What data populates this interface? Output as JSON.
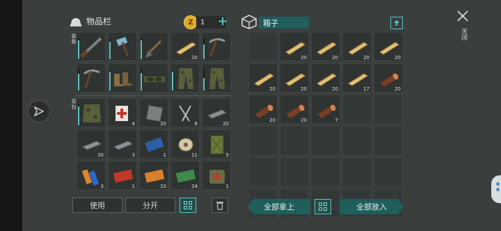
{
  "inventory": {
    "title": "物品栏",
    "coins": "1",
    "equip_label": "装备",
    "backpack_label": "背包",
    "equip_slots": [
      {
        "icon": "shotgun-icon",
        "count": "",
        "durability": 0.9
      },
      {
        "icon": "sledgehammer-icon",
        "count": "",
        "durability": 0.85
      },
      {
        "icon": "shovel-icon",
        "count": "",
        "durability": 0.9
      },
      {
        "icon": "wood-plank-icon",
        "count": "20",
        "durability": null
      },
      {
        "icon": "pickaxe-icon",
        "count": "",
        "durability": 0.7
      },
      {
        "icon": "pickaxe-icon",
        "count": "",
        "durability": 0.8
      },
      {
        "icon": "boots-icon",
        "count": "",
        "durability": 0.9
      },
      {
        "icon": "goggles-icon",
        "count": "",
        "durability": 0.85
      },
      {
        "icon": "camo-pants-icon",
        "count": "",
        "durability": 0.9
      },
      {
        "icon": "camo-pants-icon",
        "count": "",
        "durability": 0.6
      }
    ],
    "backpack_slots": [
      {
        "icon": "camo-vest-icon",
        "count": "",
        "durability": 0.9
      },
      {
        "icon": "first-aid-icon",
        "count": "4",
        "durability": null
      },
      {
        "icon": "metal-plate-icon",
        "count": "20",
        "durability": null
      },
      {
        "icon": "nails-icon",
        "count": "6",
        "durability": null
      },
      {
        "icon": "iron-bar-icon",
        "count": "20",
        "durability": null
      },
      {
        "icon": "iron-bar-icon",
        "count": "20",
        "durability": null
      },
      {
        "icon": "iron-bar-icon",
        "count": "3",
        "durability": null
      },
      {
        "icon": "circuit-board-icon",
        "count": "1",
        "durability": null
      },
      {
        "icon": "wire-spool-icon",
        "count": "11",
        "durability": null
      },
      {
        "icon": "jerry-can-icon",
        "count": "5",
        "durability": null
      },
      {
        "icon": "batteries-icon",
        "count": "3",
        "durability": null
      },
      {
        "icon": "red-ticket-icon",
        "count": "1",
        "durability": null
      },
      {
        "icon": "orange-ticket-icon",
        "count": "10",
        "durability": null
      },
      {
        "icon": "green-ticket-icon",
        "count": "24",
        "durability": null
      },
      {
        "icon": "medkit-bag-icon",
        "count": "1",
        "durability": null
      }
    ],
    "use_label": "使用",
    "split_label": "分开"
  },
  "box": {
    "title": "箱子",
    "slots": [
      {
        "icon": "",
        "count": ""
      },
      {
        "icon": "wood-plank-icon",
        "count": "20"
      },
      {
        "icon": "wood-plank-icon",
        "count": "20"
      },
      {
        "icon": "wood-plank-icon",
        "count": "20"
      },
      {
        "icon": "wood-plank-icon",
        "count": "20"
      },
      {
        "icon": "wood-plank-icon",
        "count": "20"
      },
      {
        "icon": "wood-plank-icon",
        "count": "20"
      },
      {
        "icon": "wood-plank-icon",
        "count": "20"
      },
      {
        "icon": "wood-plank-icon",
        "count": "17"
      },
      {
        "icon": "log-icon",
        "count": "20"
      },
      {
        "icon": "log-icon",
        "count": "20"
      },
      {
        "icon": "log-icon",
        "count": "20"
      },
      {
        "icon": "log-icon",
        "count": "7"
      },
      {
        "icon": "",
        "count": ""
      },
      {
        "icon": "",
        "count": ""
      },
      {
        "icon": "",
        "count": ""
      },
      {
        "icon": "",
        "count": ""
      },
      {
        "icon": "",
        "count": ""
      },
      {
        "icon": "",
        "count": ""
      },
      {
        "icon": "",
        "count": ""
      },
      {
        "icon": "",
        "count": ""
      },
      {
        "icon": "",
        "count": ""
      },
      {
        "icon": "",
        "count": ""
      },
      {
        "icon": "",
        "count": ""
      },
      {
        "icon": "",
        "count": ""
      },
      {
        "icon": "",
        "count": ""
      },
      {
        "icon": "",
        "count": ""
      },
      {
        "icon": "",
        "count": ""
      },
      {
        "icon": "",
        "count": ""
      },
      {
        "icon": "",
        "count": ""
      }
    ],
    "take_all_label": "全部拿上",
    "put_all_label": "全部放入"
  },
  "close_label": "关闭",
  "colors": {
    "accent": "#5fc3c1",
    "panel": "#3a3e3d",
    "slot": "#2f3332"
  }
}
